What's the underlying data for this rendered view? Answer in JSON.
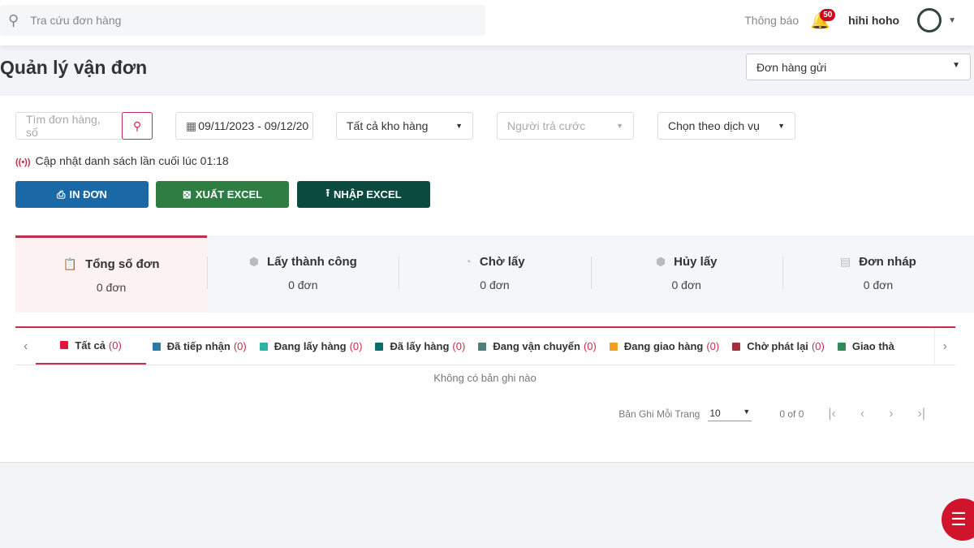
{
  "header": {
    "search_placeholder": "Tra cứu đơn hàng",
    "notifications_label": "Thông báo",
    "notification_count": "50",
    "user_name": "hihi hoho"
  },
  "page": {
    "title": "Quản lý vận đơn",
    "order_type": "Đơn hàng gửi"
  },
  "filters": {
    "search_placeholder": "Tìm đơn hàng, số",
    "date_range": "09/11/2023 - 09/12/20",
    "warehouse": "Tất cả kho hàng",
    "payer_placeholder": "Người trả cước",
    "service": "Chọn theo dịch vụ"
  },
  "update_text": "Cập nhật danh sách lần cuối lúc 01:18",
  "buttons": {
    "print": "IN ĐƠN",
    "export": "XUẤT EXCEL",
    "import": "NHẬP EXCEL"
  },
  "colors": {
    "accent": "#c0304a",
    "print": "#1a69a6",
    "export": "#2e7d43",
    "import": "#0b4a3f"
  },
  "stats": [
    {
      "label": "Tổng số đơn",
      "value": "0 đơn",
      "icon": "clipboard-icon"
    },
    {
      "label": "Lấy thành công",
      "value": "0 đơn",
      "icon": "box-check-icon"
    },
    {
      "label": "Chờ lấy",
      "value": "0 đơn",
      "icon": "clock-icon"
    },
    {
      "label": "Hủy lấy",
      "value": "0 đơn",
      "icon": "box-cancel-icon"
    },
    {
      "label": "Đơn nháp",
      "value": "0 đơn",
      "icon": "draft-icon"
    }
  ],
  "tabs": [
    {
      "label": "Tất cả",
      "count": "(0)",
      "color": "#e0143c"
    },
    {
      "label": "Đã tiếp nhận",
      "count": "(0)",
      "color": "#2a7aa8"
    },
    {
      "label": "Đang lấy hàng",
      "count": "(0)",
      "color": "#2bb3a3"
    },
    {
      "label": "Đã lấy hàng",
      "count": "(0)",
      "color": "#0d6e6e"
    },
    {
      "label": "Đang vận chuyển",
      "count": "(0)",
      "color": "#4f7f7a"
    },
    {
      "label": "Đang giao hàng",
      "count": "(0)",
      "color": "#f0a020"
    },
    {
      "label": "Chờ phát lại",
      "count": "(0)",
      "color": "#a03040"
    },
    {
      "label": "Giao thà",
      "count": "",
      "color": "#2e8b57"
    }
  ],
  "empty_text": "Không có bản ghi nào",
  "pagination": {
    "label": "Bản Ghi Mỗi Trang",
    "page_size": "10",
    "range": "0 of 0"
  }
}
